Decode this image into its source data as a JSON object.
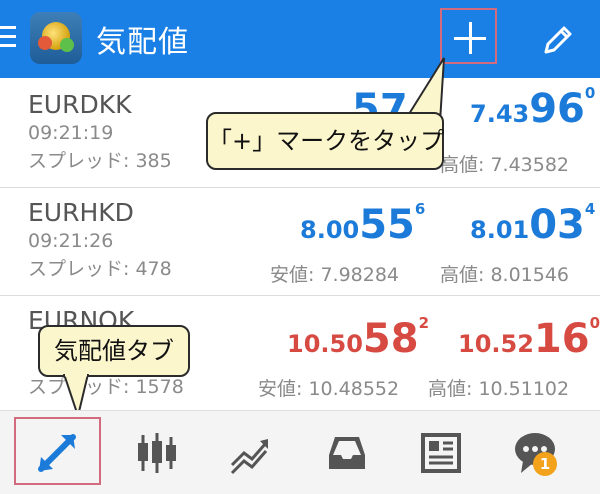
{
  "header": {
    "title": "気配値",
    "icons": [
      "menu-icon",
      "metatrader-logo",
      "plus-icon",
      "pencil-icon"
    ],
    "bg_color": "#1a80e6"
  },
  "quotes": [
    {
      "symbol": "EURDKK",
      "time": "09:21:19",
      "spread": "スプレッド: 385",
      "bid": {
        "small": "",
        "big": "57",
        "sup": ""
      },
      "ask": {
        "small": "7.43",
        "big": "96",
        "sup": "0"
      },
      "low": "",
      "high": "高値: 7.43582",
      "color": "blue"
    },
    {
      "symbol": "EURHKD",
      "time": "09:21:26",
      "spread": "スプレッド: 478",
      "bid": {
        "small": "8.00",
        "big": "55",
        "sup": "6"
      },
      "ask": {
        "small": "8.01",
        "big": "03",
        "sup": "4"
      },
      "low": "安値: 7.98284",
      "high": "高値: 8.01546",
      "color": "blue"
    },
    {
      "symbol": "EURNOK",
      "time": "",
      "spread": "スプレッド: 1578",
      "bid": {
        "small": "10.50",
        "big": "58",
        "sup": "2"
      },
      "ask": {
        "small": "10.52",
        "big": "16",
        "sup": "0"
      },
      "low": "安値: 10.48552",
      "high": "高値: 10.51102",
      "color": "red"
    }
  ],
  "callouts": {
    "plus": "「+」マークをタップ",
    "tab": "気配値タブ"
  },
  "nav": {
    "items": [
      "quotes-icon",
      "chart-icon",
      "trade-icon",
      "history-icon",
      "news-icon",
      "chat-icon"
    ],
    "badge": "1"
  },
  "colors": {
    "price_up": "#1c7bd9",
    "price_down": "#d64a42",
    "highlight": "#d36b7e",
    "callout_bg": "#fcf6cd"
  }
}
